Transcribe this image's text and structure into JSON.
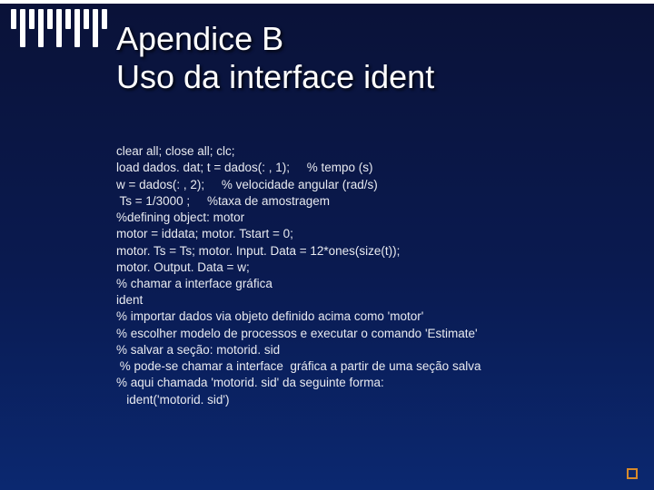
{
  "slide": {
    "title_line1": "Apendice B",
    "title_line2": "Uso da interface ident",
    "code": [
      "clear all; close all; clc;",
      "load dados. dat; t = dados(: , 1);     % tempo (s)",
      "w = dados(: , 2);     % velocidade angular (rad/s)",
      " Ts = 1/3000 ;     %taxa de amostragem",
      "%defining object: motor",
      "motor = iddata; motor. Tstart = 0;",
      "motor. Ts = Ts; motor. Input. Data = 12*ones(size(t));",
      "motor. Output. Data = w;",
      "% chamar a interface gráfica",
      "ident",
      "% importar dados via objeto definido acima como 'motor'",
      "% escolher modelo de processos e executar o comando 'Estimate'",
      "% salvar a seção: motorid. sid",
      " % pode-se chamar a interface  gráfica a partir de uma seção salva",
      "% aqui chamada 'motorid. sid' da seguinte forma:",
      "   ident('motorid. sid')"
    ]
  }
}
